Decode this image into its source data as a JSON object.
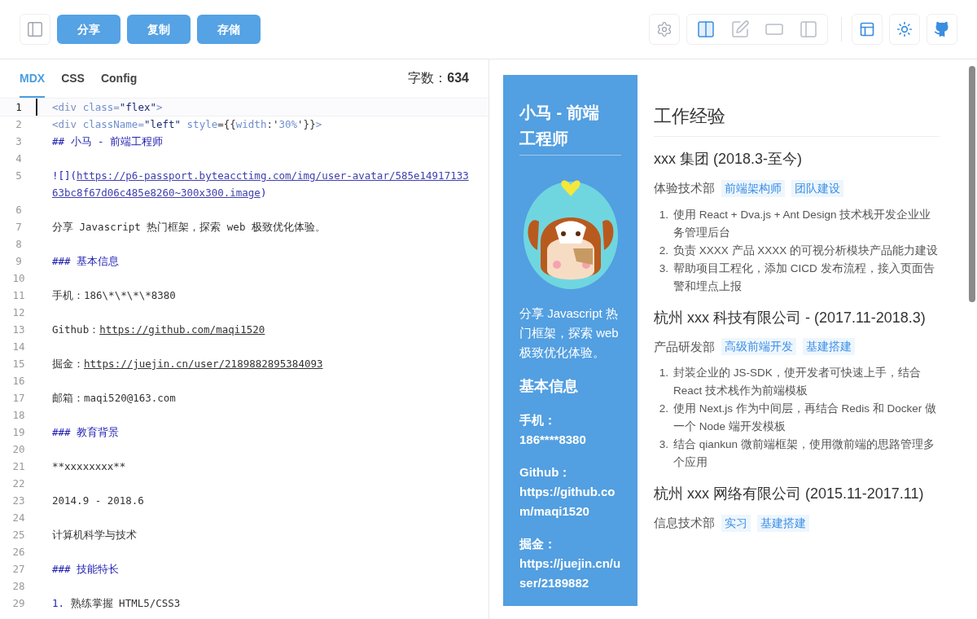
{
  "toolbar": {
    "actions": [
      {
        "label": "分享"
      },
      {
        "label": "复制"
      },
      {
        "label": "存储"
      }
    ],
    "view_modes": [
      {
        "kind": "split",
        "selected": true
      },
      {
        "kind": "edit",
        "selected": false
      },
      {
        "kind": "preview",
        "selected": false
      },
      {
        "kind": "narrow",
        "selected": false
      }
    ]
  },
  "editor": {
    "tabs": [
      {
        "label": "MDX",
        "selected": true
      },
      {
        "label": "CSS",
        "selected": false
      },
      {
        "label": "Config",
        "selected": false
      }
    ],
    "word_count": "字数：**634**",
    "lines": [
      {
        "number": "1",
        "active": true,
        "segments": [
          {
            "kind": "tag",
            "text": "<div "
          },
          {
            "kind": "attr",
            "text": "class"
          },
          {
            "kind": "tag",
            "text": "="
          },
          {
            "kind": "string",
            "text": "\"flex\""
          },
          {
            "kind": "tag",
            "text": ">"
          }
        ]
      },
      {
        "number": "2",
        "active": false,
        "segments": [
          {
            "kind": "tag",
            "text": "<div "
          },
          {
            "kind": "attr",
            "text": "className"
          },
          {
            "kind": "tag",
            "text": "="
          },
          {
            "kind": "string",
            "text": "\"left\""
          },
          {
            "kind": "attr",
            "text": " style"
          },
          {
            "kind": "plain",
            "text": "={{"
          },
          {
            "kind": "attr",
            "text": "width"
          },
          {
            "kind": "plain",
            "text": ":'"
          },
          {
            "kind": "attr",
            "text": "30%"
          },
          {
            "kind": "plain",
            "text": "'}}"
          },
          {
            "kind": "tag",
            "text": ">"
          }
        ]
      },
      {
        "number": "3",
        "active": false,
        "segments": [
          {
            "kind": "heading",
            "text": "## 小马 - 前端工程师"
          }
        ]
      },
      {
        "number": "4",
        "active": false
      },
      {
        "number": "5",
        "active": false,
        "segments": [
          {
            "kind": "heading",
            "text": "![]("
          },
          {
            "kind": "link",
            "text": "https://p6-passport.byteacctimg.com/img/user-avatar/585e1491713363bc8f67d06c485e8260~300x300.image"
          },
          {
            "kind": "heading",
            "text": ")"
          }
        ]
      },
      {
        "number": "6",
        "active": false
      },
      {
        "number": "7",
        "active": false,
        "segments": [
          {
            "kind": "plain",
            "text": "分享 Javascript 热门框架，探索 web 极致优化体验。"
          }
        ]
      },
      {
        "number": "8",
        "active": false
      },
      {
        "number": "9",
        "active": false,
        "segments": [
          {
            "kind": "heading",
            "text": "### 基本信息"
          }
        ]
      },
      {
        "number": "10",
        "active": false
      },
      {
        "number": "11",
        "active": false,
        "segments": [
          {
            "kind": "plain",
            "text": "手机：186\\*\\*\\*\\*8380"
          }
        ]
      },
      {
        "number": "12",
        "active": false
      },
      {
        "number": "13",
        "active": false,
        "segments": [
          {
            "kind": "plain",
            "text": "Github："
          },
          {
            "kind": "url",
            "text": "https://github.com/maqi1520"
          }
        ]
      },
      {
        "number": "14",
        "active": false
      },
      {
        "number": "15",
        "active": false,
        "segments": [
          {
            "kind": "plain",
            "text": "掘金："
          },
          {
            "kind": "url",
            "text": "https://juejin.cn/user/2189882895384093"
          }
        ]
      },
      {
        "number": "16",
        "active": false
      },
      {
        "number": "17",
        "active": false,
        "segments": [
          {
            "kind": "plain",
            "text": "邮箱：maqi520@163.com"
          }
        ]
      },
      {
        "number": "18",
        "active": false
      },
      {
        "number": "19",
        "active": false,
        "segments": [
          {
            "kind": "heading",
            "text": "### 教育背景"
          }
        ]
      },
      {
        "number": "20",
        "active": false
      },
      {
        "number": "21",
        "active": false,
        "segments": [
          {
            "kind": "plain",
            "text": "**xxxxxxxx**"
          }
        ]
      },
      {
        "number": "22",
        "active": false
      },
      {
        "number": "23",
        "active": false,
        "segments": [
          {
            "kind": "plain",
            "text": "2014.9 - 2018.6"
          }
        ]
      },
      {
        "number": "24",
        "active": false
      },
      {
        "number": "25",
        "active": false,
        "segments": [
          {
            "kind": "plain",
            "text": "计算机科学与技术"
          }
        ]
      },
      {
        "number": "26",
        "active": false
      },
      {
        "number": "27",
        "active": false,
        "segments": [
          {
            "kind": "heading",
            "text": "### 技能特长"
          }
        ]
      },
      {
        "number": "28",
        "active": false
      },
      {
        "number": "29",
        "active": false,
        "segments": [
          {
            "kind": "heading",
            "text": "1. "
          },
          {
            "kind": "plain",
            "text": "熟练掌握 HTML5/CSS3"
          }
        ]
      }
    ]
  },
  "preview": {
    "sidebar": {
      "name": "小马 - 前端工程师",
      "intro": "分享 Javascript 热门框架，探索 web 极致优化体验。",
      "section_title": "基本信息",
      "contacts": [
        {
          "label": "手机：",
          "value": "186****8380"
        },
        {
          "label": "Github：",
          "value": "https://github.com/maqi1520"
        },
        {
          "label": "掘金：",
          "value": "https://juejin.cn/user/2189882"
        }
      ]
    },
    "heading": "工作经验",
    "jobs": [
      {
        "title": "xxx 集团 (2018.3-至今)",
        "department": "体验技术部",
        "tags": [
          "前端架构师",
          "团队建设"
        ],
        "items": [
          {
            "marker": "1.",
            "text": "使用 React + Dva.js + Ant Design 技术栈开发企业业务管理后台"
          },
          {
            "marker": "2.",
            "text": "负责 XXXX 产品 XXXX 的可视分析模块产品能力建设"
          },
          {
            "marker": "3.",
            "text": "帮助项目工程化，添加 CICD 发布流程，接入页面告警和埋点上报"
          }
        ]
      },
      {
        "title": "杭州 xxx 科技有限公司 - (2017.11-2018.3)",
        "department": "产品研发部",
        "tags": [
          "高级前端开发",
          "基建搭建"
        ],
        "items": [
          {
            "marker": "1.",
            "text": "封装企业的 JS-SDK，使开发者可快速上手，结合 React 技术栈作为前端模板"
          },
          {
            "marker": "2.",
            "text": "使用 Next.js 作为中间层，再结合 Redis 和 Docker 做一个 Node 端开发模板"
          },
          {
            "marker": "3.",
            "text": "结合 qiankun 微前端框架，使用微前端的思路管理多个应用"
          }
        ]
      },
      {
        "title": "杭州 xxx 网络有限公司 (2015.11-2017.11)",
        "department": "信息技术部",
        "tags": [
          "实习",
          "基建搭建"
        ]
      }
    ]
  }
}
